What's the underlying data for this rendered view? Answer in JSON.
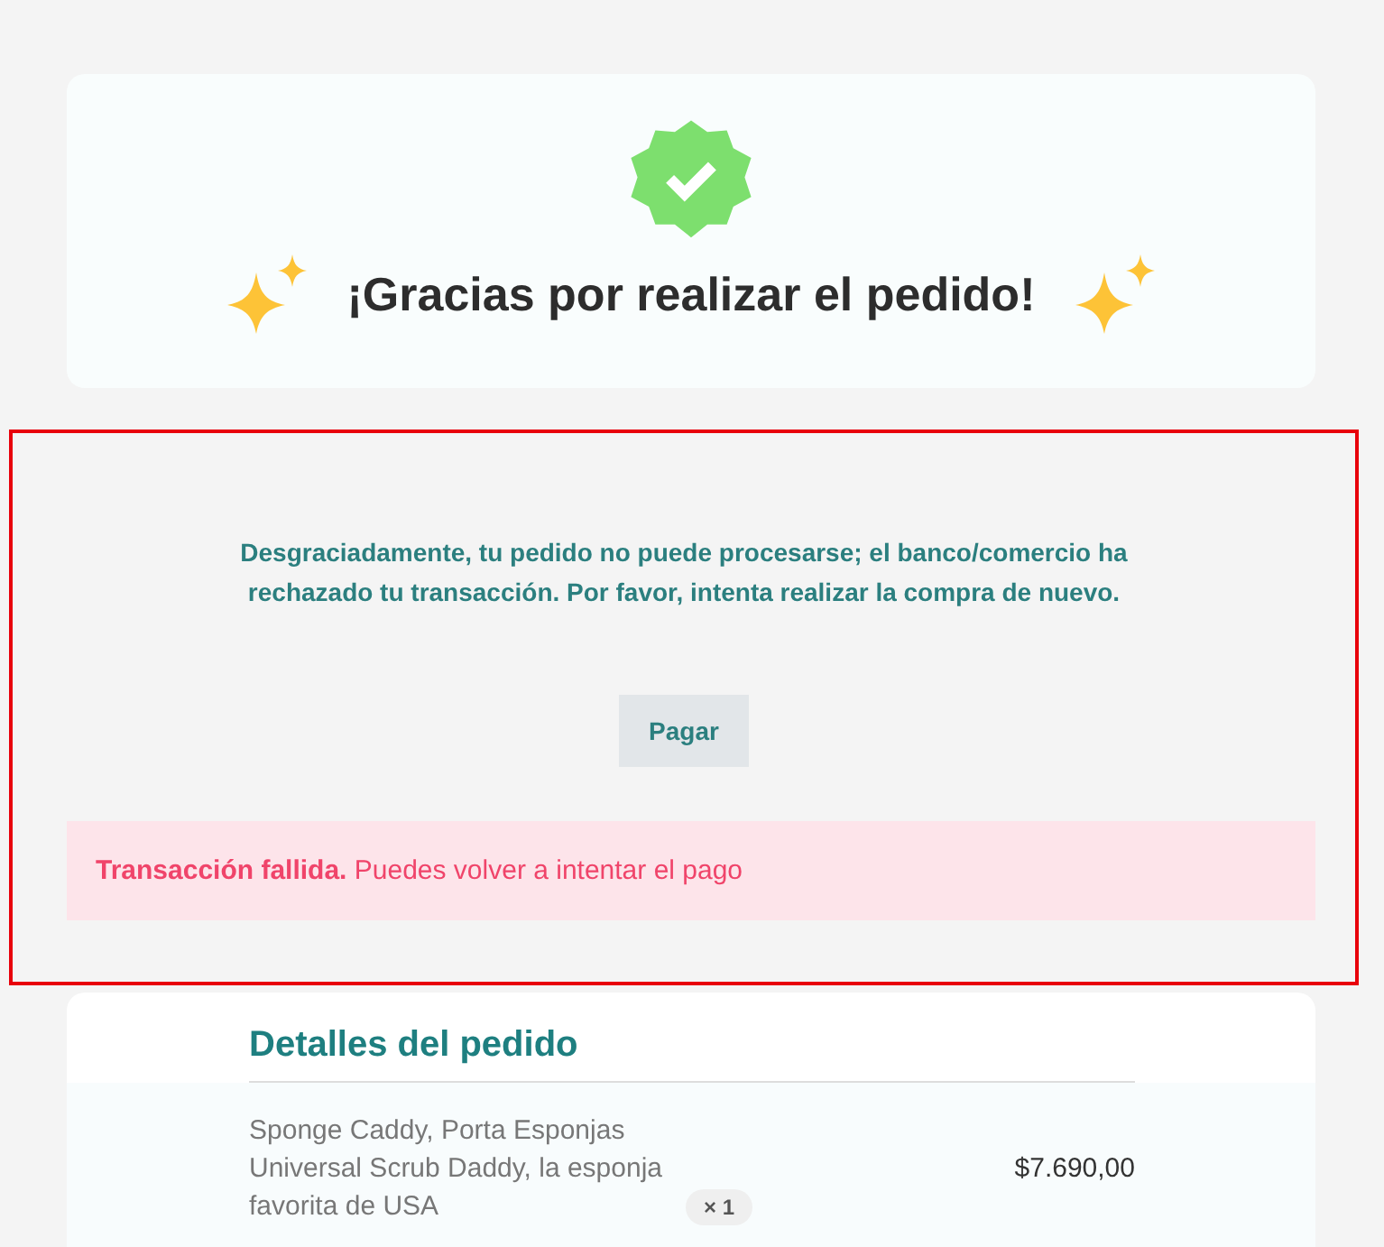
{
  "header": {
    "title": "¡Gracias por realizar el pedido!"
  },
  "payment_error": {
    "message": "Desgraciadamente, tu pedido no puede procesarse; el banco/comercio ha rechazado tu transacción. Por favor, intenta realizar la compra de nuevo.",
    "button": "Pagar",
    "alert": "**Transacción fallida.** Puedes volver a intentar el pago"
  },
  "order_details": {
    "title": "Detalles del pedido",
    "items": [
      {
        "name": "Sponge Caddy, Porta Esponjas Universal Scrub Daddy, la esponja favorita de USA",
        "quantity": "× 1",
        "price": "$7.690,00"
      }
    ]
  }
}
